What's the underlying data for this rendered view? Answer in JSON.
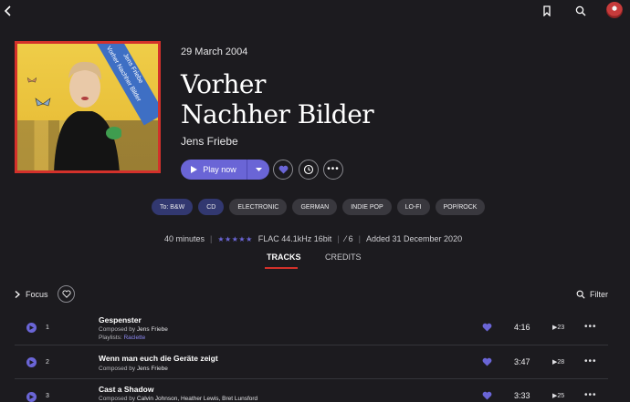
{
  "album": {
    "date": "29 March 2004",
    "title_line1": "Vorher",
    "title_line2": "Nachher Bilder",
    "artist": "Jens Friebe",
    "cover_banner_artist": "Jens Friebe",
    "cover_banner_title": "Vorher Nachher Bilder"
  },
  "actions": {
    "play_label": "Play now"
  },
  "tags": [
    "To: B&W",
    "CD",
    "ELECTRONIC",
    "GERMAN",
    "INDIE POP",
    "LO-FI",
    "POP/ROCK"
  ],
  "meta": {
    "duration": "40 minutes",
    "rating_stars": "★★★★★",
    "format": "FLAC 44.1kHz 16bit",
    "discs": "6",
    "added": "Added 31 December 2020"
  },
  "tabs": {
    "tracks": "TRACKS",
    "credits": "CREDITS"
  },
  "controls": {
    "focus": "Focus",
    "filter": "Filter"
  },
  "tracks": [
    {
      "number": "1",
      "title": "Gespenster",
      "composed_prefix": "Composed by ",
      "composer": "Jens Friebe",
      "playlists_prefix": "Playlists: ",
      "playlist": "Raclette",
      "duration": "4:16",
      "plays": "23"
    },
    {
      "number": "2",
      "title": "Wenn man euch die Geräte zeigt",
      "composed_prefix": "Composed by ",
      "composer": "Jens Friebe",
      "duration": "3:47",
      "plays": "28"
    },
    {
      "number": "3",
      "title": "Cast a Shadow",
      "composed_prefix": "Composed by ",
      "composer": "Calvin Johnson, Heather Lewis, Bret Lunsford",
      "duration": "3:33",
      "plays": "25"
    }
  ],
  "colors": {
    "background": "#1c1b1f",
    "accent": "#6a65d6",
    "tab_indicator": "#d3312b",
    "tag_highlight": "#323870"
  }
}
